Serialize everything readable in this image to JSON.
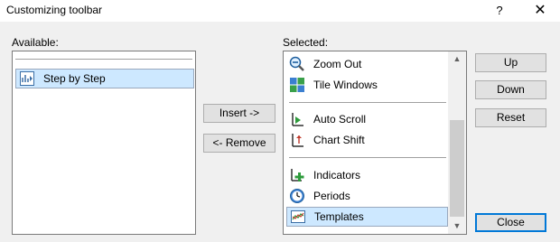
{
  "window": {
    "title": "Customizing toolbar",
    "help_label": "?",
    "close_label": "✕"
  },
  "available": {
    "label": "Available:",
    "items": [
      {
        "label": "Step by Step",
        "icon": "step-by-step-icon",
        "selected": true
      }
    ]
  },
  "selected": {
    "label": "Selected:",
    "items": [
      {
        "label": "Zoom Out",
        "icon": "zoom-out-icon"
      },
      {
        "label": "Tile Windows",
        "icon": "tile-windows-icon"
      },
      {
        "label": "Auto Scroll",
        "icon": "auto-scroll-icon"
      },
      {
        "label": "Chart Shift",
        "icon": "chart-shift-icon"
      },
      {
        "label": "Indicators",
        "icon": "indicators-icon"
      },
      {
        "label": "Periods",
        "icon": "periods-icon"
      },
      {
        "label": "Templates",
        "icon": "templates-icon",
        "selected": true
      }
    ]
  },
  "buttons": {
    "insert": "Insert ->",
    "remove": "<- Remove",
    "up": "Up",
    "down": "Down",
    "reset": "Reset",
    "close": "Close"
  },
  "scrollbar": {
    "up_arrow": "▲",
    "down_arrow": "▼"
  },
  "colors": {
    "selection_bg": "#cde8ff",
    "focus_border": "#0078d7"
  }
}
